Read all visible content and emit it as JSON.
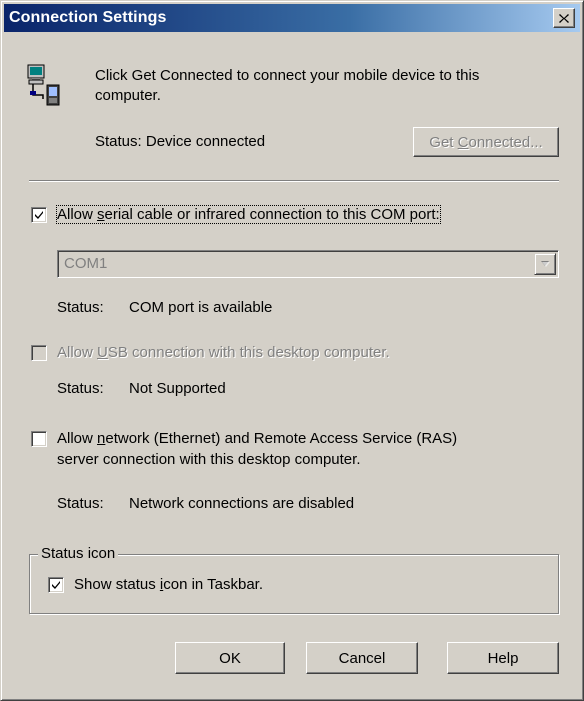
{
  "window": {
    "title": "Connection Settings"
  },
  "intro": {
    "line1": "Click Get Connected to connect your mobile device to this",
    "line2": "computer.",
    "status": "Status: Device connected"
  },
  "get_connected": {
    "pre": "Get ",
    "accel": "C",
    "post": "onnected...",
    "enabled": false
  },
  "serial": {
    "checked": true,
    "label_pre": "Allow ",
    "label_accel": "s",
    "label_post": "erial cable or infrared connection to this COM port:",
    "port": "COM1",
    "status_label": "Status:",
    "status_value": "COM port is available"
  },
  "usb": {
    "checked": false,
    "enabled": false,
    "label_pre": "Allow ",
    "label_accel": "U",
    "label_post": "SB connection with this desktop computer.",
    "status_label": "Status:",
    "status_value": "Not Supported"
  },
  "network": {
    "checked": false,
    "label_pre": "Allow ",
    "label_accel": "n",
    "label_post": "etwork (Ethernet) and Remote Access Service (RAS)",
    "label_line2": "server connection with this desktop computer.",
    "status_label": "Status:",
    "status_value": "Network connections are disabled"
  },
  "status_icon_group": {
    "legend": "Status icon",
    "checked": true,
    "label_pre": "Show status ",
    "label_accel": "i",
    "label_post": "con in Taskbar."
  },
  "buttons": {
    "ok": "OK",
    "cancel": "Cancel",
    "help": "Help"
  },
  "colors": {
    "title_start": "#0a246a",
    "title_end": "#a6caf0",
    "face": "#d4d0c8",
    "disabled_text": "#808080"
  },
  "icons": {
    "device": "desktop-and-mobile-device-icon",
    "close": "close-icon",
    "check": "checkmark-icon",
    "dropdown": "dropdown-arrow-icon"
  }
}
